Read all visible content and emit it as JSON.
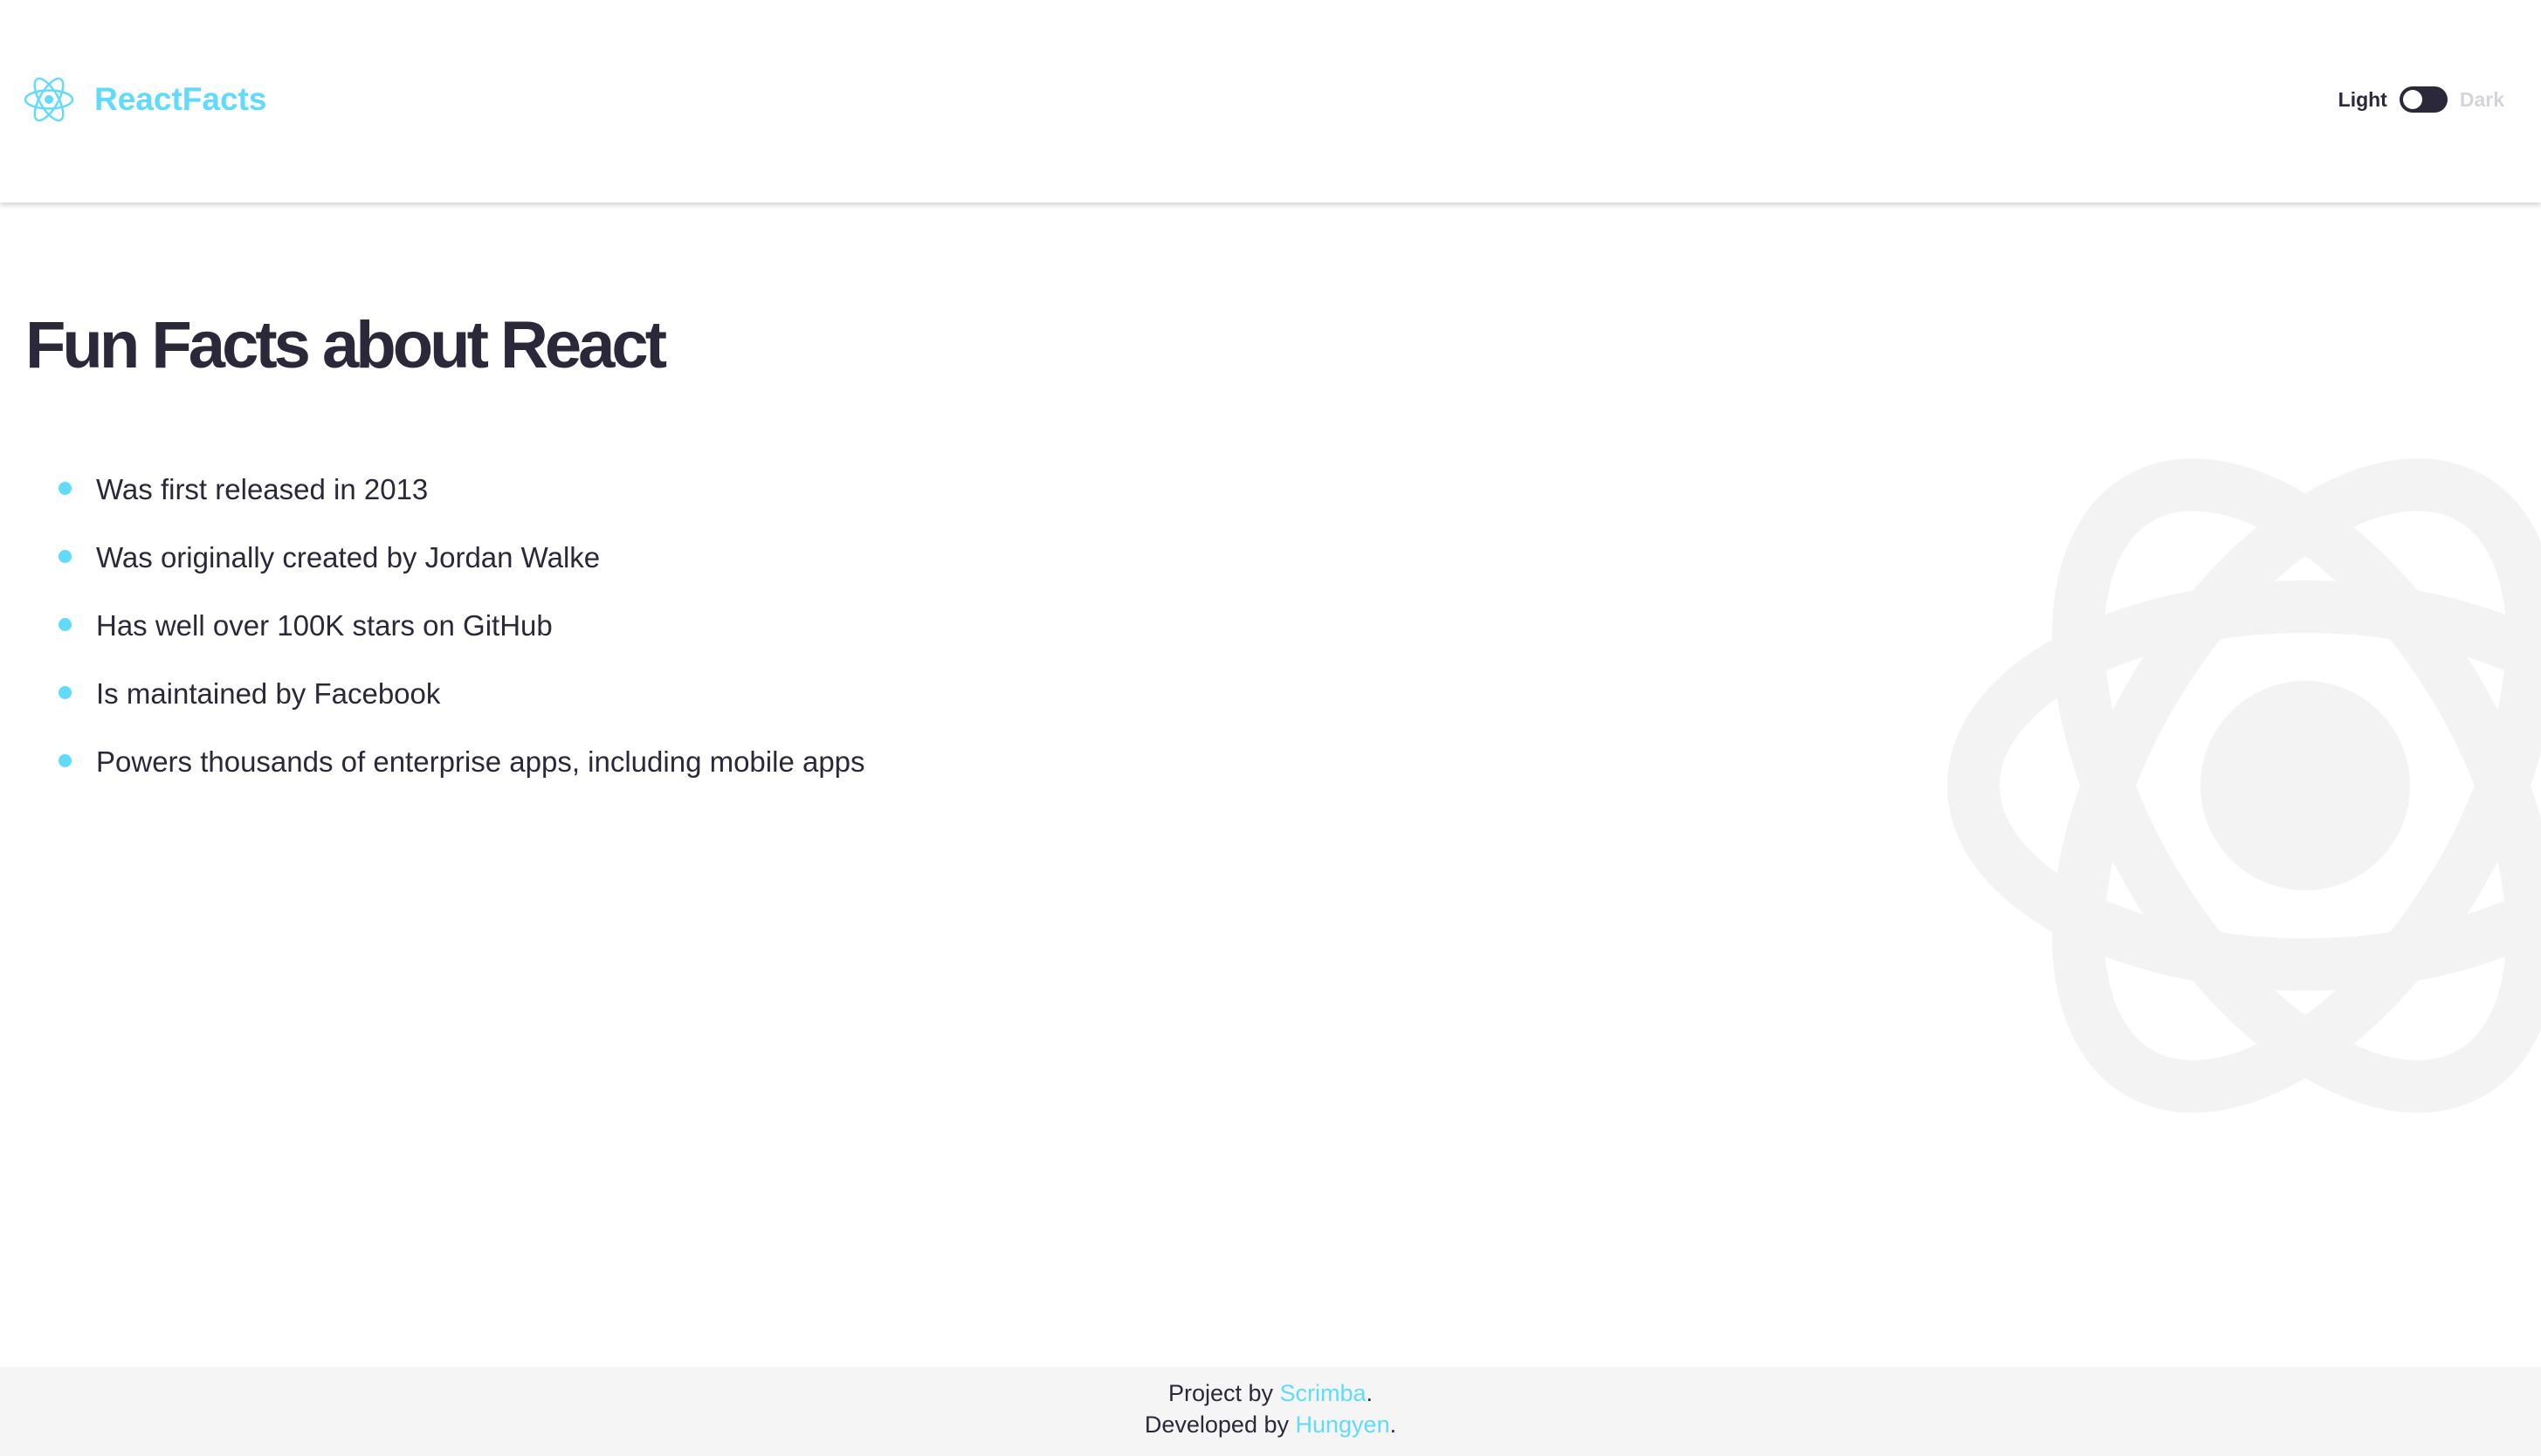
{
  "header": {
    "brand_name": "ReactFacts",
    "logo_icon": "react-atom-icon",
    "toggle": {
      "light_label": "Light",
      "dark_label": "Dark",
      "state": "light"
    }
  },
  "main": {
    "title": "Fun Facts about React",
    "facts": [
      "Was first released in 2013",
      "Was originally created by Jordan Walke",
      "Has well over 100K stars on GitHub",
      "Is maintained by Facebook",
      "Powers thousands of enterprise apps, including mobile apps"
    ]
  },
  "footer": {
    "line1_prefix": "Project by ",
    "line1_link": "Scrimba",
    "line1_suffix": ".",
    "line2_prefix": "Developed by ",
    "line2_link": "Hungyen",
    "line2_suffix": "."
  },
  "colors": {
    "accent": "#61dafb",
    "text": "#2b283a",
    "muted": "#d5d4d8",
    "footer_bg": "#f5f5f5",
    "watermark": "#f3f3f3"
  }
}
